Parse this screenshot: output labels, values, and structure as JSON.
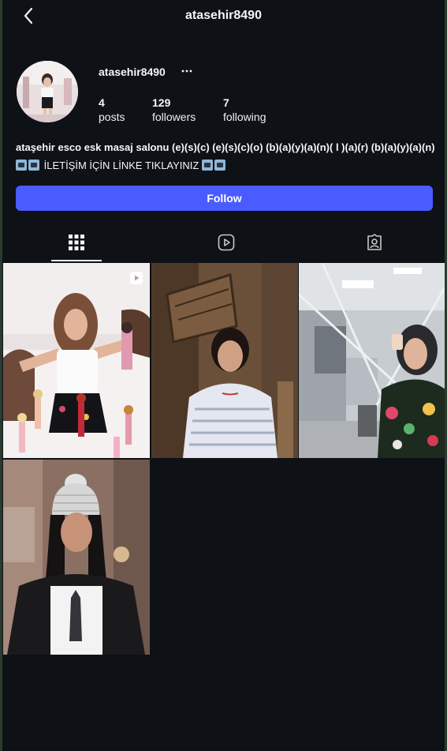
{
  "header": {
    "title": "atasehir8490",
    "back_icon": "chevron-left-icon"
  },
  "profile": {
    "username": "atasehir8490",
    "more_icon": "ellipsis-icon",
    "stats": [
      {
        "value": "4",
        "label": "posts"
      },
      {
        "value": "129",
        "label": "followers"
      },
      {
        "value": "7",
        "label": "following"
      }
    ],
    "bio_title": "ataşehir esco esk masaj salonu (e)(s)(c) (e)(s)(c)(o) (b)(a)(y)(a)(n)( l )(a)(r) (b)(a)(y)(a)(n)",
    "bio_line": "İLETİŞİM İÇİN LİNKE TIKLAYINIZ",
    "follow_label": "Follow",
    "accent_color": "#4a5bff"
  },
  "tabs": [
    {
      "name": "posts",
      "icon": "grid-icon",
      "active": true
    },
    {
      "name": "reels",
      "icon": "reels-icon",
      "active": false
    },
    {
      "name": "tagged",
      "icon": "tagged-user-icon",
      "active": false
    }
  ],
  "posts": [
    {
      "subject": "woman with dolls on bed",
      "is_reel": true
    },
    {
      "subject": "girl in striped t-shirt by wooden door",
      "is_reel": false
    },
    {
      "subject": "woman in hijab taking mirror selfie",
      "is_reel": false
    },
    {
      "subject": "woman in knit beanie on street",
      "is_reel": false
    }
  ]
}
